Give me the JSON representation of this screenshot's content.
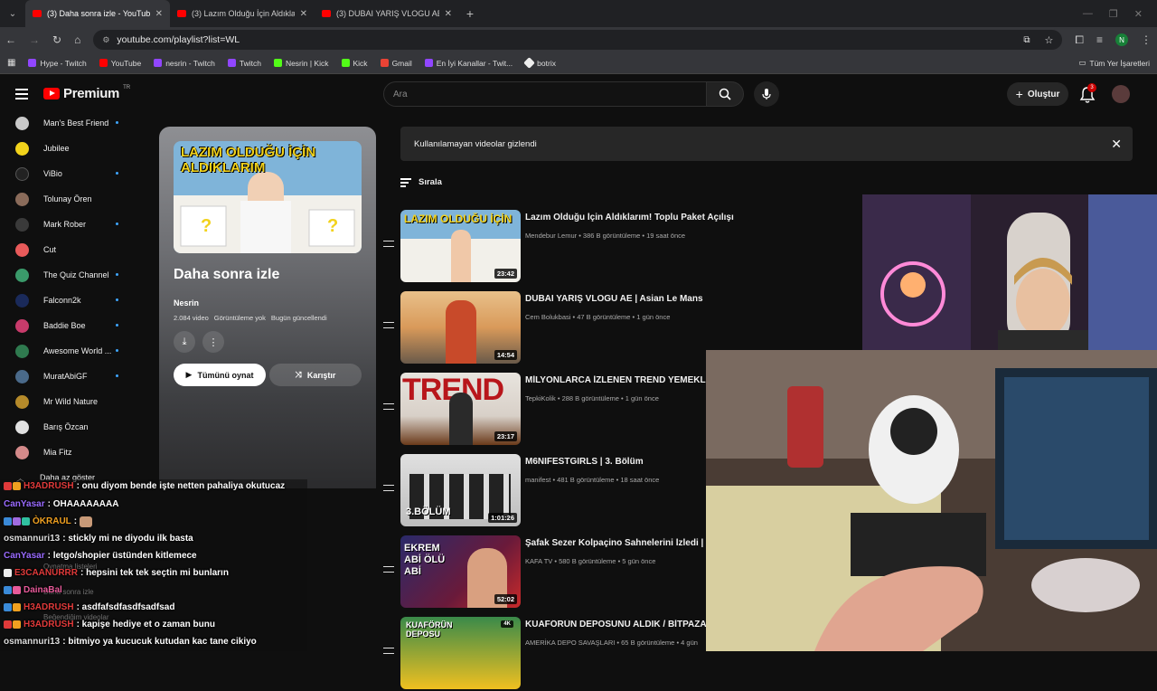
{
  "browser": {
    "tabs": [
      {
        "title": "(3) Daha sonra izle - YouTube",
        "active": true
      },
      {
        "title": "(3) Lazım Olduğu İçin Aldıklarım",
        "active": false
      },
      {
        "title": "(3) DUBAI YARIŞ VLOGU AE | As",
        "active": false
      }
    ],
    "url": "youtube.com/playlist?list=WL",
    "bookmarks": [
      "Hype - Twitch",
      "YouTube",
      "nesrin - Twitch",
      "Twitch",
      "Nesrin | Kick",
      "Kick",
      "Gmail",
      "En İyi Kanallar - Twit...",
      "botrix"
    ],
    "all_bookmarks": "Tüm Yer İşaretleri",
    "profile_initial": "N"
  },
  "header": {
    "logo_text": "Premium",
    "logo_region": "TR",
    "search_placeholder": "Ara",
    "create_label": "Oluştur",
    "notification_count": "3"
  },
  "sidebar": {
    "subscriptions": [
      {
        "name": "Man's Best Friend",
        "color": "#c9c9c9",
        "new": true
      },
      {
        "name": "Jubilee",
        "color": "#f2d31b",
        "new": false
      },
      {
        "name": "ViBio",
        "color": "#222222",
        "new": true
      },
      {
        "name": "Tolunay Ören",
        "color": "#8a6b5a",
        "new": false
      },
      {
        "name": "Mark Rober",
        "color": "#3a3a3a",
        "new": true
      },
      {
        "name": "Cut",
        "color": "#e85a5a",
        "new": false
      },
      {
        "name": "The Quiz Channel",
        "color": "#3a9a6a",
        "new": true
      },
      {
        "name": "Falconn2k",
        "color": "#1a2a5a",
        "new": true
      },
      {
        "name": "Baddie Boe",
        "color": "#c83b6b",
        "new": true
      },
      {
        "name": "Awesome World ...",
        "color": "#2f7a4f",
        "new": true
      },
      {
        "name": "MuratAbiGF",
        "color": "#4a6a8a",
        "new": true
      },
      {
        "name": "Mr Wild Nature",
        "color": "#b58a2a",
        "new": false
      },
      {
        "name": "Barış Özcan",
        "color": "#e0e0e0",
        "new": false
      },
      {
        "name": "Mia Fitz",
        "color": "#d48a8a",
        "new": false
      }
    ],
    "show_less": "Daha az göster"
  },
  "playlist": {
    "thumb_text": "LAZIM OLDUĞU İÇİN ALDIKLARIM",
    "title": "Daha sonra izle",
    "owner": "Nesrin",
    "video_count": "2.084 video",
    "views": "Görüntüleme yok",
    "updated": "Bugün güncellendi",
    "play_all": "Tümünü oynat",
    "shuffle": "Karıştır"
  },
  "banner": {
    "text": "Kullanılamayan videolar gizlendi"
  },
  "sort_label": "Sırala",
  "videos": [
    {
      "title": "Lazım Olduğu İçin Aldıklarım! Toplu Paket Açılışı",
      "channel": "Mendebur Lemur",
      "views": "386 B görüntüleme",
      "ago": "19 saat önce",
      "duration": "23:42",
      "thumb_text": "LAZIM OLDUĞU İÇİN",
      "c1": "#d9c46a",
      "c2": "#f0eee8"
    },
    {
      "title": "DUBAI YARIŞ VLOGU AE | Asian Le Mans",
      "channel": "Cem Bolukbasi",
      "views": "47 B görüntüleme",
      "ago": "1 gün önce",
      "duration": "14:54",
      "thumb_text": "",
      "c1": "#e8c08a",
      "c2": "#c86a3a"
    },
    {
      "title": "MİLYONLARCA İZLENEN TREND YEMEKLE",
      "channel": "TepkiKolik",
      "views": "288 B görüntüleme",
      "ago": "1 gün önce",
      "duration": "23:17",
      "thumb_text": "TREND",
      "c1": "#e8e4de",
      "c2": "#6a3a1a"
    },
    {
      "title": "M6NIFESTGIRLS | 3. Bölüm",
      "channel": "manifest",
      "views": "481 B görüntüleme",
      "ago": "18 saat önce",
      "duration": "1:01:26",
      "thumb_text": "3.BÖLÜM",
      "c1": "#d8d8d8",
      "c2": "#8a8a8a"
    },
    {
      "title": "Şafak Sezer Kolpaçino Sahnelerini İzledi |",
      "channel": "KAFA TV",
      "views": "580 B görüntüleme",
      "ago": "5 gün önce",
      "duration": "52:02",
      "thumb_text": "EKREM ABİ ÖLÜ ABİ",
      "c1": "#c82a2a",
      "c2": "#2a2a6a"
    },
    {
      "title": "KUAFÖRÜN DEPOSUNU ALDIK / BİTPAZAI",
      "channel": "AMERİKA DEPO SAVAŞLARI",
      "views": "65 B görüntüleme",
      "ago": "4 gün",
      "duration": "",
      "badge": "4K",
      "thumb_text": "KUAFÖRÜN DEPOSU",
      "c1": "#3a8a4a",
      "c2": "#f0c020"
    }
  ],
  "chat": [
    {
      "user": "H3ADRUSH",
      "text": ": onu diyom bende işte netten pahaliya okutucaz",
      "color": "#e03a3a"
    },
    {
      "user": "CanYasar",
      "text": ": OHAAAAAAAA",
      "color": "#9a6bff"
    },
    {
      "user": "ÒKRAUL",
      "text": ":",
      "color": "#f0a020"
    },
    {
      "user": "osmannuri13",
      "text": ": stickly mi ne diyodu ilk basta",
      "color": "#dddddd"
    },
    {
      "user": "CanYasar",
      "text": ": letgo/shopier üstünden kitlemece",
      "color": "#9a6bff"
    },
    {
      "user": "E3CAANURRR",
      "text": ": hepsini tek tek seçtin mi bunların",
      "color": "#e03a3a"
    },
    {
      "user": "DainaBal",
      "text": "",
      "color": "#e85a9a"
    },
    {
      "user": "H3ADRUSH",
      "text": ": asdfafsdfasdfsadfsad",
      "color": "#e03a3a"
    },
    {
      "user": "H3ADRUSH",
      "text": ": kapişe hediye et o zaman bunu",
      "color": "#e03a3a"
    },
    {
      "user": "osmannuri13",
      "text": ": bitmiyo ya kucucuk kutudan kac tane cikiyo",
      "color": "#dddddd"
    }
  ],
  "chat_ghost": [
    "Oynatma listeleri",
    "Daha sonra izle",
    "Beğendiğim videolar"
  ]
}
